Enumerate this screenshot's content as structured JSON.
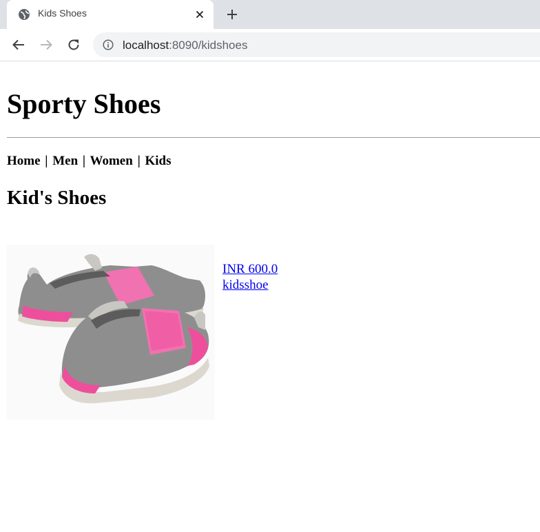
{
  "browser": {
    "tab": {
      "title": "Kids Shoes",
      "favicon": "globe-icon",
      "close": "close-icon"
    },
    "new_tab": "plus-icon",
    "toolbar": {
      "back": "arrow-back-icon",
      "forward": "arrow-forward-icon",
      "reload": "reload-icon"
    },
    "address": {
      "info_icon": "info-icon",
      "host": "localhost",
      "path": ":8090/kidshoes"
    }
  },
  "page": {
    "title": "Sporty Shoes",
    "nav": {
      "home": "Home",
      "men": "Men",
      "women": "Women",
      "kids": "Kids",
      "separator": "|"
    },
    "section_title": "Kid's Shoes",
    "products": [
      {
        "image": "kids-slip-on-shoe-image",
        "price": "INR 600.0",
        "name": "kidsshoe"
      }
    ]
  },
  "colors": {
    "tabstrip": "#dee1e6",
    "omnibox": "#f1f3f4",
    "link": "#0000ee",
    "shoe_pink": "#ee4f9c",
    "shoe_grey": "#8e8e8e"
  }
}
